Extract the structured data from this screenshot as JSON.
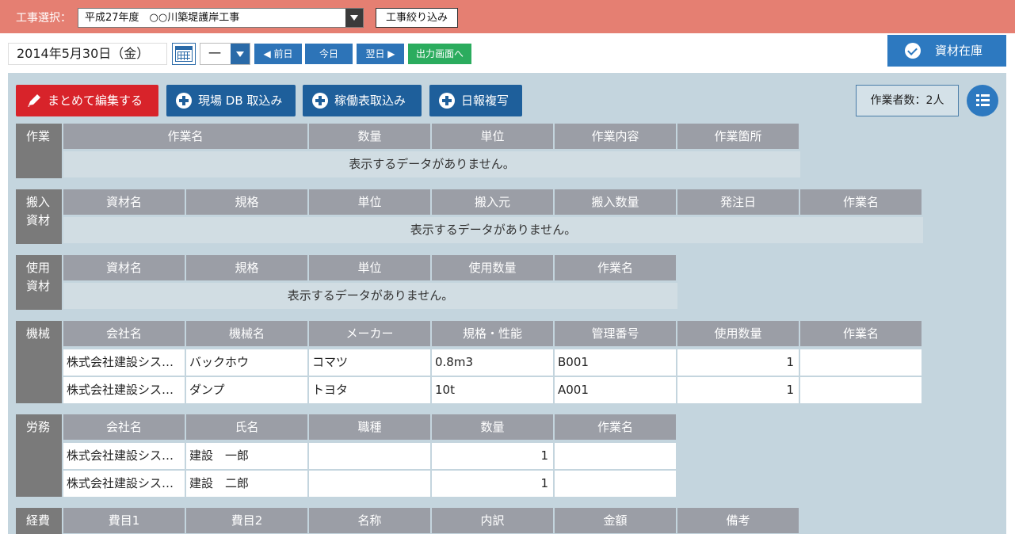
{
  "header": {
    "project_label": "工事選択：",
    "project_value": "平成27年度　○○川築堤護岸工事",
    "filter_button": "工事絞り込み"
  },
  "toolbar": {
    "date": "2014年5月30日（金）",
    "shift": "一",
    "prev": "◀ 前日",
    "today": "今日",
    "next": "翌日 ▶",
    "output": "出力画面へ",
    "stock": "資材在庫"
  },
  "actions": {
    "edit_all": "まとめて編集する",
    "import_db": "現場 DB 取込み",
    "import_operation": "稼働表取込み",
    "copy_report": "日報複写",
    "workers_count": "作業者数：2人"
  },
  "colors": {
    "topbar": "#e57f72",
    "panel": "#c4d5de",
    "primary": "#2d79c0",
    "danger": "#d8232a",
    "success": "#2bac5e"
  },
  "empty_message": "表示するデータがありません。",
  "sections": {
    "work": {
      "label": "作業",
      "headers": [
        "作業名",
        "数量",
        "単位",
        "作業内容",
        "作業箇所"
      ]
    },
    "material_in": {
      "label_line1": "搬入",
      "label_line2": "資材",
      "headers": [
        "資材名",
        "規格",
        "単位",
        "搬入元",
        "搬入数量",
        "発注日",
        "作業名"
      ]
    },
    "material_use": {
      "label_line1": "使用",
      "label_line2": "資材",
      "headers": [
        "資材名",
        "規格",
        "単位",
        "使用数量",
        "作業名"
      ]
    },
    "machine": {
      "label": "機械",
      "headers": [
        "会社名",
        "機械名",
        "メーカー",
        "規格・性能",
        "管理番号",
        "使用数量",
        "作業名"
      ],
      "rows": [
        [
          "株式会社建設シス…",
          "バックホウ",
          "コマツ",
          "0.8m3",
          "B001",
          "1",
          ""
        ],
        [
          "株式会社建設シス…",
          "ダンプ",
          "トヨタ",
          "10t",
          "A001",
          "1",
          ""
        ]
      ]
    },
    "labor": {
      "label": "労務",
      "headers": [
        "会社名",
        "氏名",
        "職種",
        "数量",
        "作業名"
      ],
      "rows": [
        [
          "株式会社建設シス…",
          "建設　一郎",
          "",
          "1",
          ""
        ],
        [
          "株式会社建設シス…",
          "建設　二郎",
          "",
          "1",
          ""
        ]
      ]
    },
    "expense": {
      "label": "経費",
      "headers": [
        "費目1",
        "費目2",
        "名称",
        "内訳",
        "金額",
        "備考"
      ]
    }
  }
}
